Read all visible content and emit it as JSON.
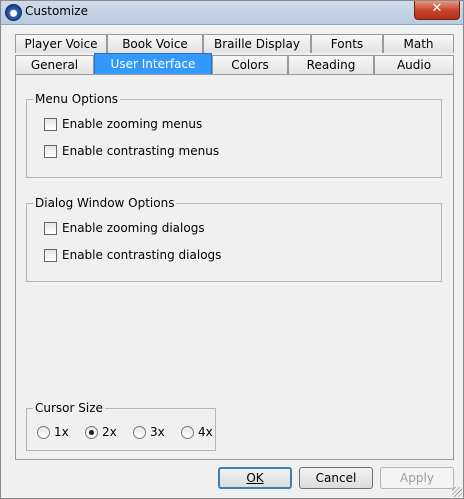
{
  "window": {
    "title": "Customize",
    "close_glyph": "✕"
  },
  "tabs_row_back": [
    "Player Voice",
    "Book Voice",
    "Braille Display",
    "Fonts",
    "Math"
  ],
  "tabs_row_front": [
    "General",
    "User Interface",
    "Colors",
    "Reading",
    "Audio"
  ],
  "active_tab": "User Interface",
  "menu_options": {
    "legend": "Menu Options",
    "items": [
      {
        "label": "Enable zooming menus",
        "checked": false
      },
      {
        "label": "Enable contrasting menus",
        "checked": false
      }
    ]
  },
  "dialog_options": {
    "legend": "Dialog Window Options",
    "items": [
      {
        "label": "Enable zooming dialogs",
        "checked": false
      },
      {
        "label": "Enable contrasting dialogs",
        "checked": false
      }
    ]
  },
  "cursor_size": {
    "legend": "Cursor Size",
    "options": [
      "1x",
      "2x",
      "3x",
      "4x"
    ],
    "selected": "2x"
  },
  "buttons": {
    "ok": "OK",
    "cancel": "Cancel",
    "apply": "Apply"
  },
  "colors": {
    "active_tab": "#3399ff",
    "title_bar": "#c4d5e8",
    "close_button": "#c7432a"
  },
  "icons": {
    "app": "app-logo-icon",
    "close": "close-icon",
    "resize": "resize-grip-icon"
  }
}
